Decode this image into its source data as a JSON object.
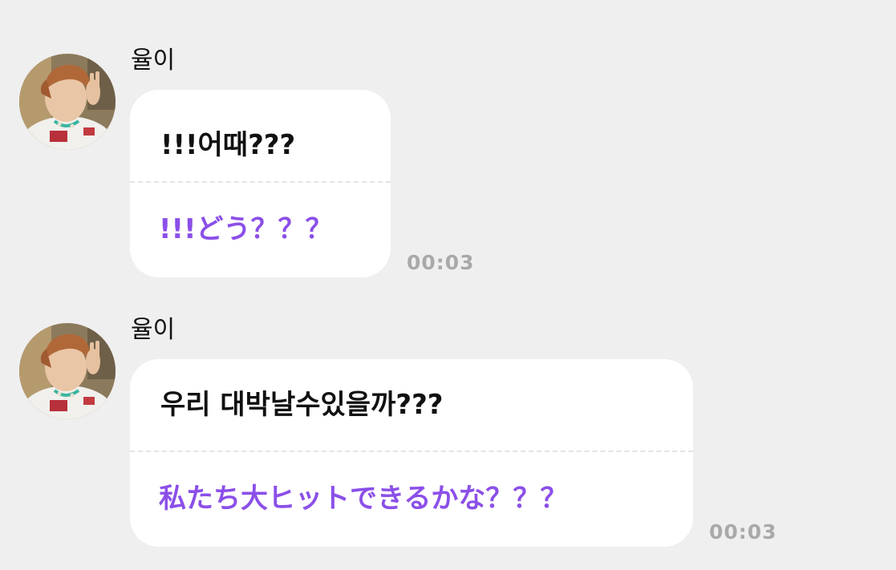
{
  "messages": [
    {
      "sender": "율이",
      "original": "!!!어때???",
      "translation": "!!!どう？？？",
      "time": "00:03",
      "avatar_icon": "profile-photo"
    },
    {
      "sender": "율이",
      "original": "우리 대박날수있을까???",
      "translation": "私たち大ヒットできるかな？？？",
      "time": "00:03",
      "avatar_icon": "profile-photo"
    }
  ],
  "colors": {
    "background": "#efefef",
    "bubble": "#ffffff",
    "original_text": "#111111",
    "translation_text": "#8b4fe8",
    "timestamp": "#a9a9a9"
  }
}
